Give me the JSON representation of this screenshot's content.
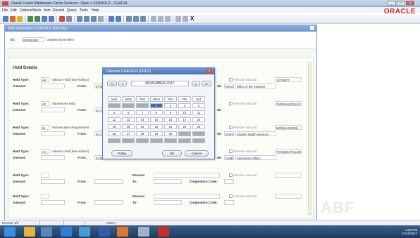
{
  "window": {
    "title": "Oracle Fusion Middleware Forms Services : Open > SOAHOLD - GUACAL",
    "buttons": [
      "_",
      "□",
      "X"
    ]
  },
  "menu": [
    "File",
    "Edit",
    "Options",
    "Block",
    "Item",
    "Record",
    "Query",
    "Tools",
    "Help"
  ],
  "brand": "ORACLE",
  "inner_title": "Hold Information SOAHOLD (FROZE)",
  "id_row": {
    "label": "ID:",
    "value": "R00392082",
    "name": "Outwest Muriel Bette"
  },
  "section_title": "Hold Details",
  "labels": {
    "hold_type": "Hold Type:",
    "amount": "Amount:",
    "from": "From:",
    "to": "To:",
    "reason": "Reason:",
    "orig_code": "Origination Code:",
    "release": "Release Indicator"
  },
  "holds": [
    {
      "type": "AR",
      "desc": "Advisor Hold (See Advisor)",
      "from": "27-O",
      "user": "JSTREET",
      "orig": "REGS",
      "orig_desc": "Office of the Registrar"
    },
    {
      "type": "AF",
      "desc": "Admissions Hold",
      "from": "20-J",
      "user": "TARISHAECCLES",
      "orig": "",
      "orig_desc": ""
    },
    {
      "type": "IH",
      "desc": "Immunization Requirement",
      "from": "20-J",
      "user": "MONICASADEN",
      "orig": "SHSV",
      "orig_desc": "Student Health Services"
    },
    {
      "type": "AH",
      "desc": "Advisor Hold (See Advisor)",
      "from": "01-M",
      "user": "THADDEAPAULMO",
      "orig": "ADMS",
      "orig_desc": "Admissions Office"
    },
    {
      "type": "",
      "desc": "",
      "from": "",
      "user": "",
      "orig": "",
      "orig_desc": ""
    },
    {
      "type": "",
      "desc": "",
      "from": "",
      "user": "",
      "orig": "",
      "orig_desc": ""
    }
  ],
  "calendar": {
    "title": "Calendar GUACALN (FROZ)",
    "month": "NOVEMBER 2017",
    "nav": [
      "<<",
      "<",
      ">",
      ">>"
    ],
    "dows": [
      "SUN",
      "MON",
      "TUE",
      "WED",
      "THU",
      "FRI",
      "SAT"
    ],
    "weeks": [
      [
        "",
        "",
        "",
        "1",
        "2",
        "3",
        "4"
      ],
      [
        "5",
        "6",
        "7",
        "8",
        "9",
        "10",
        "11"
      ],
      [
        "12",
        "13",
        "14",
        "15",
        "16",
        "17",
        "18"
      ],
      [
        "19",
        "20",
        "21",
        "22",
        "23",
        "24",
        "25"
      ],
      [
        "26",
        "27",
        "28",
        "29",
        "30",
        "",
        ""
      ],
      [
        "",
        "",
        "",
        "",
        "",
        "",
        ""
      ]
    ],
    "selected": "1",
    "buttons": {
      "today": "Today",
      "ok": "OK",
      "cancel": "Cancel"
    }
  },
  "status": {
    "record": "Record: 1/6",
    "osc": "<OSC>"
  },
  "tray": {
    "time": "1:25 PM",
    "date": "11/14/2017"
  },
  "watermark": "ABF"
}
